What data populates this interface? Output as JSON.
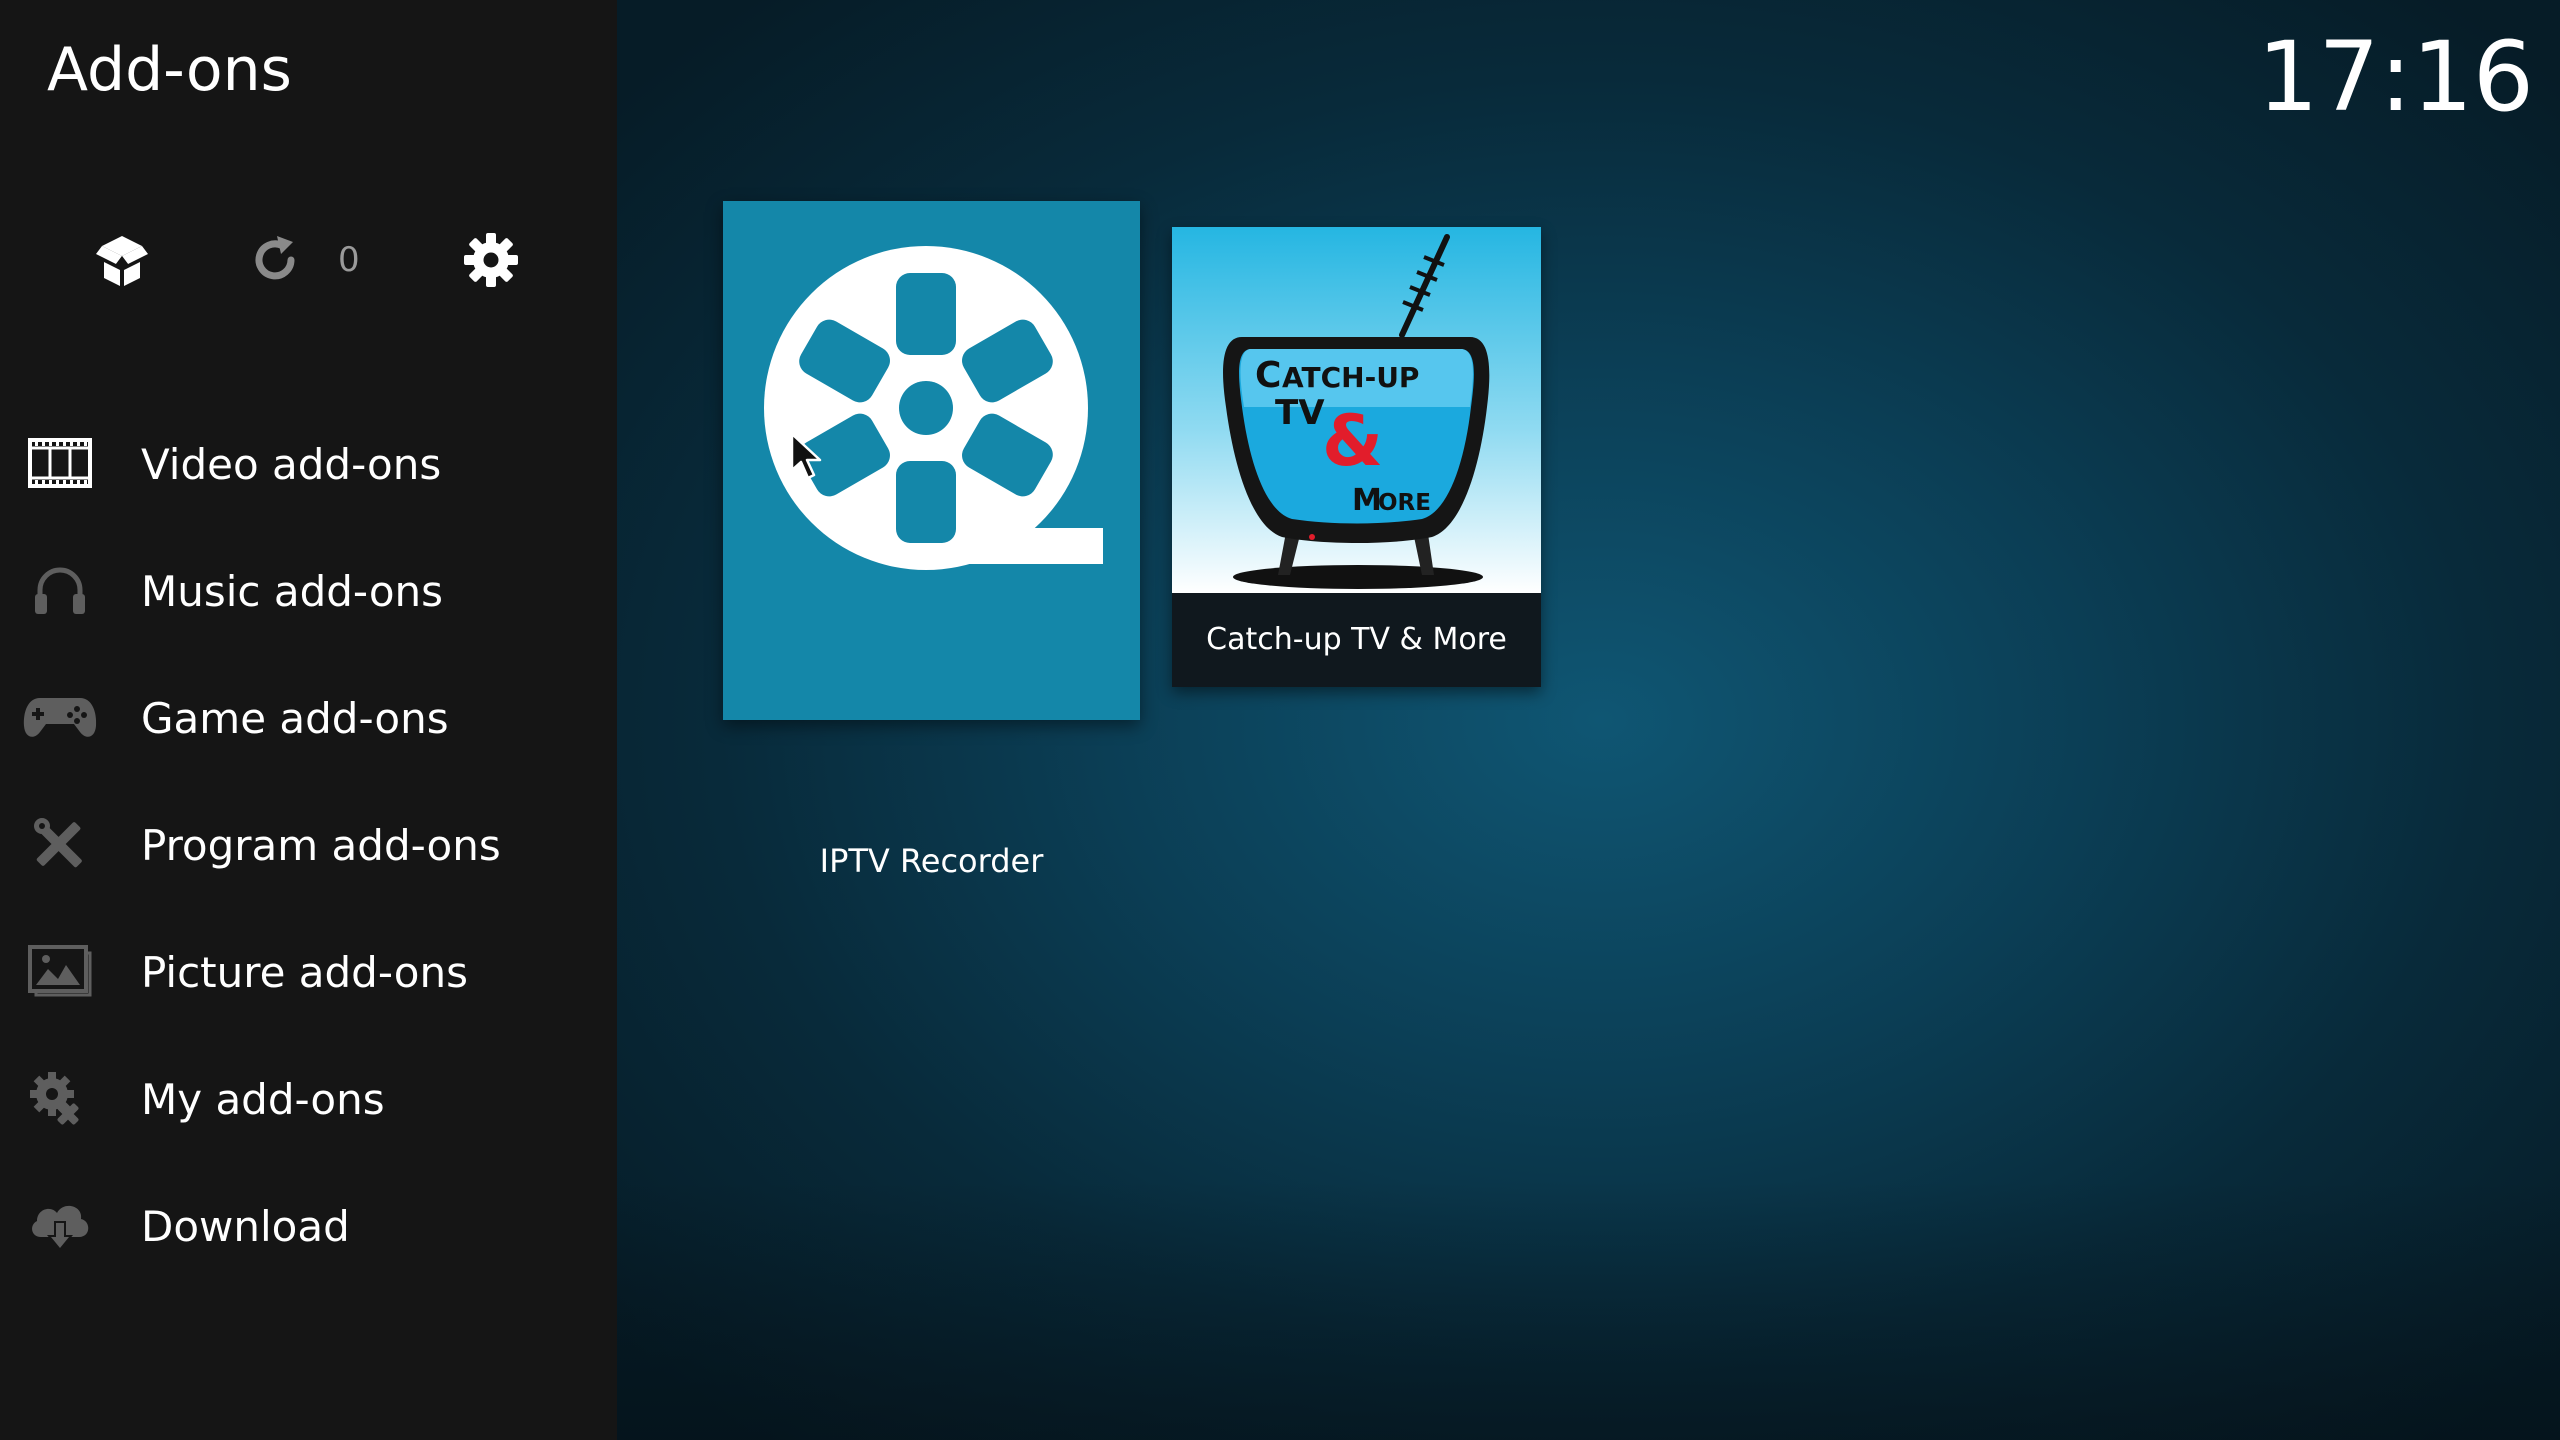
{
  "header": {
    "title": "Add-ons",
    "clock": "17:16"
  },
  "toolbar": {
    "addon_browser_icon": "open-box-icon",
    "updates_icon": "refresh-icon",
    "updates_count": "0",
    "settings_icon": "gear-icon"
  },
  "sidebar": {
    "items": [
      {
        "label": "Video add-ons",
        "icon": "film-strip-icon"
      },
      {
        "label": "Music add-ons",
        "icon": "headphones-icon"
      },
      {
        "label": "Game add-ons",
        "icon": "gamepad-icon"
      },
      {
        "label": "Program add-ons",
        "icon": "tools-icon"
      },
      {
        "label": "Picture add-ons",
        "icon": "picture-icon"
      },
      {
        "label": "My add-ons",
        "icon": "gears-icon"
      },
      {
        "label": "Download",
        "icon": "cloud-download-icon"
      }
    ]
  },
  "addons": [
    {
      "name": "IPTV Recorder",
      "icon": "film-reel-icon",
      "focused": true
    },
    {
      "name": "Catch-up TV & More",
      "icon": "retro-tv-icon",
      "focused": false,
      "art_text": {
        "line1": "Catch-up",
        "line2": "TV",
        "ampersand": "&",
        "line3": "More"
      }
    }
  ],
  "colors": {
    "sidebar_bg": "#151515",
    "focused_tile": "#1487a9",
    "background": "#0b3e55",
    "ampersand": "#e21d2b"
  }
}
